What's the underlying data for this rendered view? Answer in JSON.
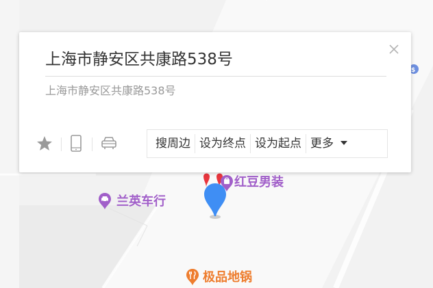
{
  "info_card": {
    "title": "上海市静安区共康路538号",
    "address": "上海市静安区共康路538号",
    "close_symbol": "×",
    "actions": {
      "nearby": "搜周边",
      "set_destination": "设为终点",
      "set_origin": "设为起点",
      "more": "更多"
    },
    "icons": [
      "star-icon",
      "phone-icon",
      "car-icon"
    ]
  },
  "map": {
    "pois": [
      {
        "name": "红豆男装",
        "icon": "shopping-icon",
        "color": "#a15fc9"
      },
      {
        "name": "兰英车行",
        "icon": "car-icon",
        "color": "#a15fc9"
      },
      {
        "name": "极品地锅",
        "icon": "restaurant-icon",
        "color": "#ee7d2e"
      }
    ],
    "marker_color": "#3f8ef4",
    "marker_secondary_color": "#e8363e"
  }
}
